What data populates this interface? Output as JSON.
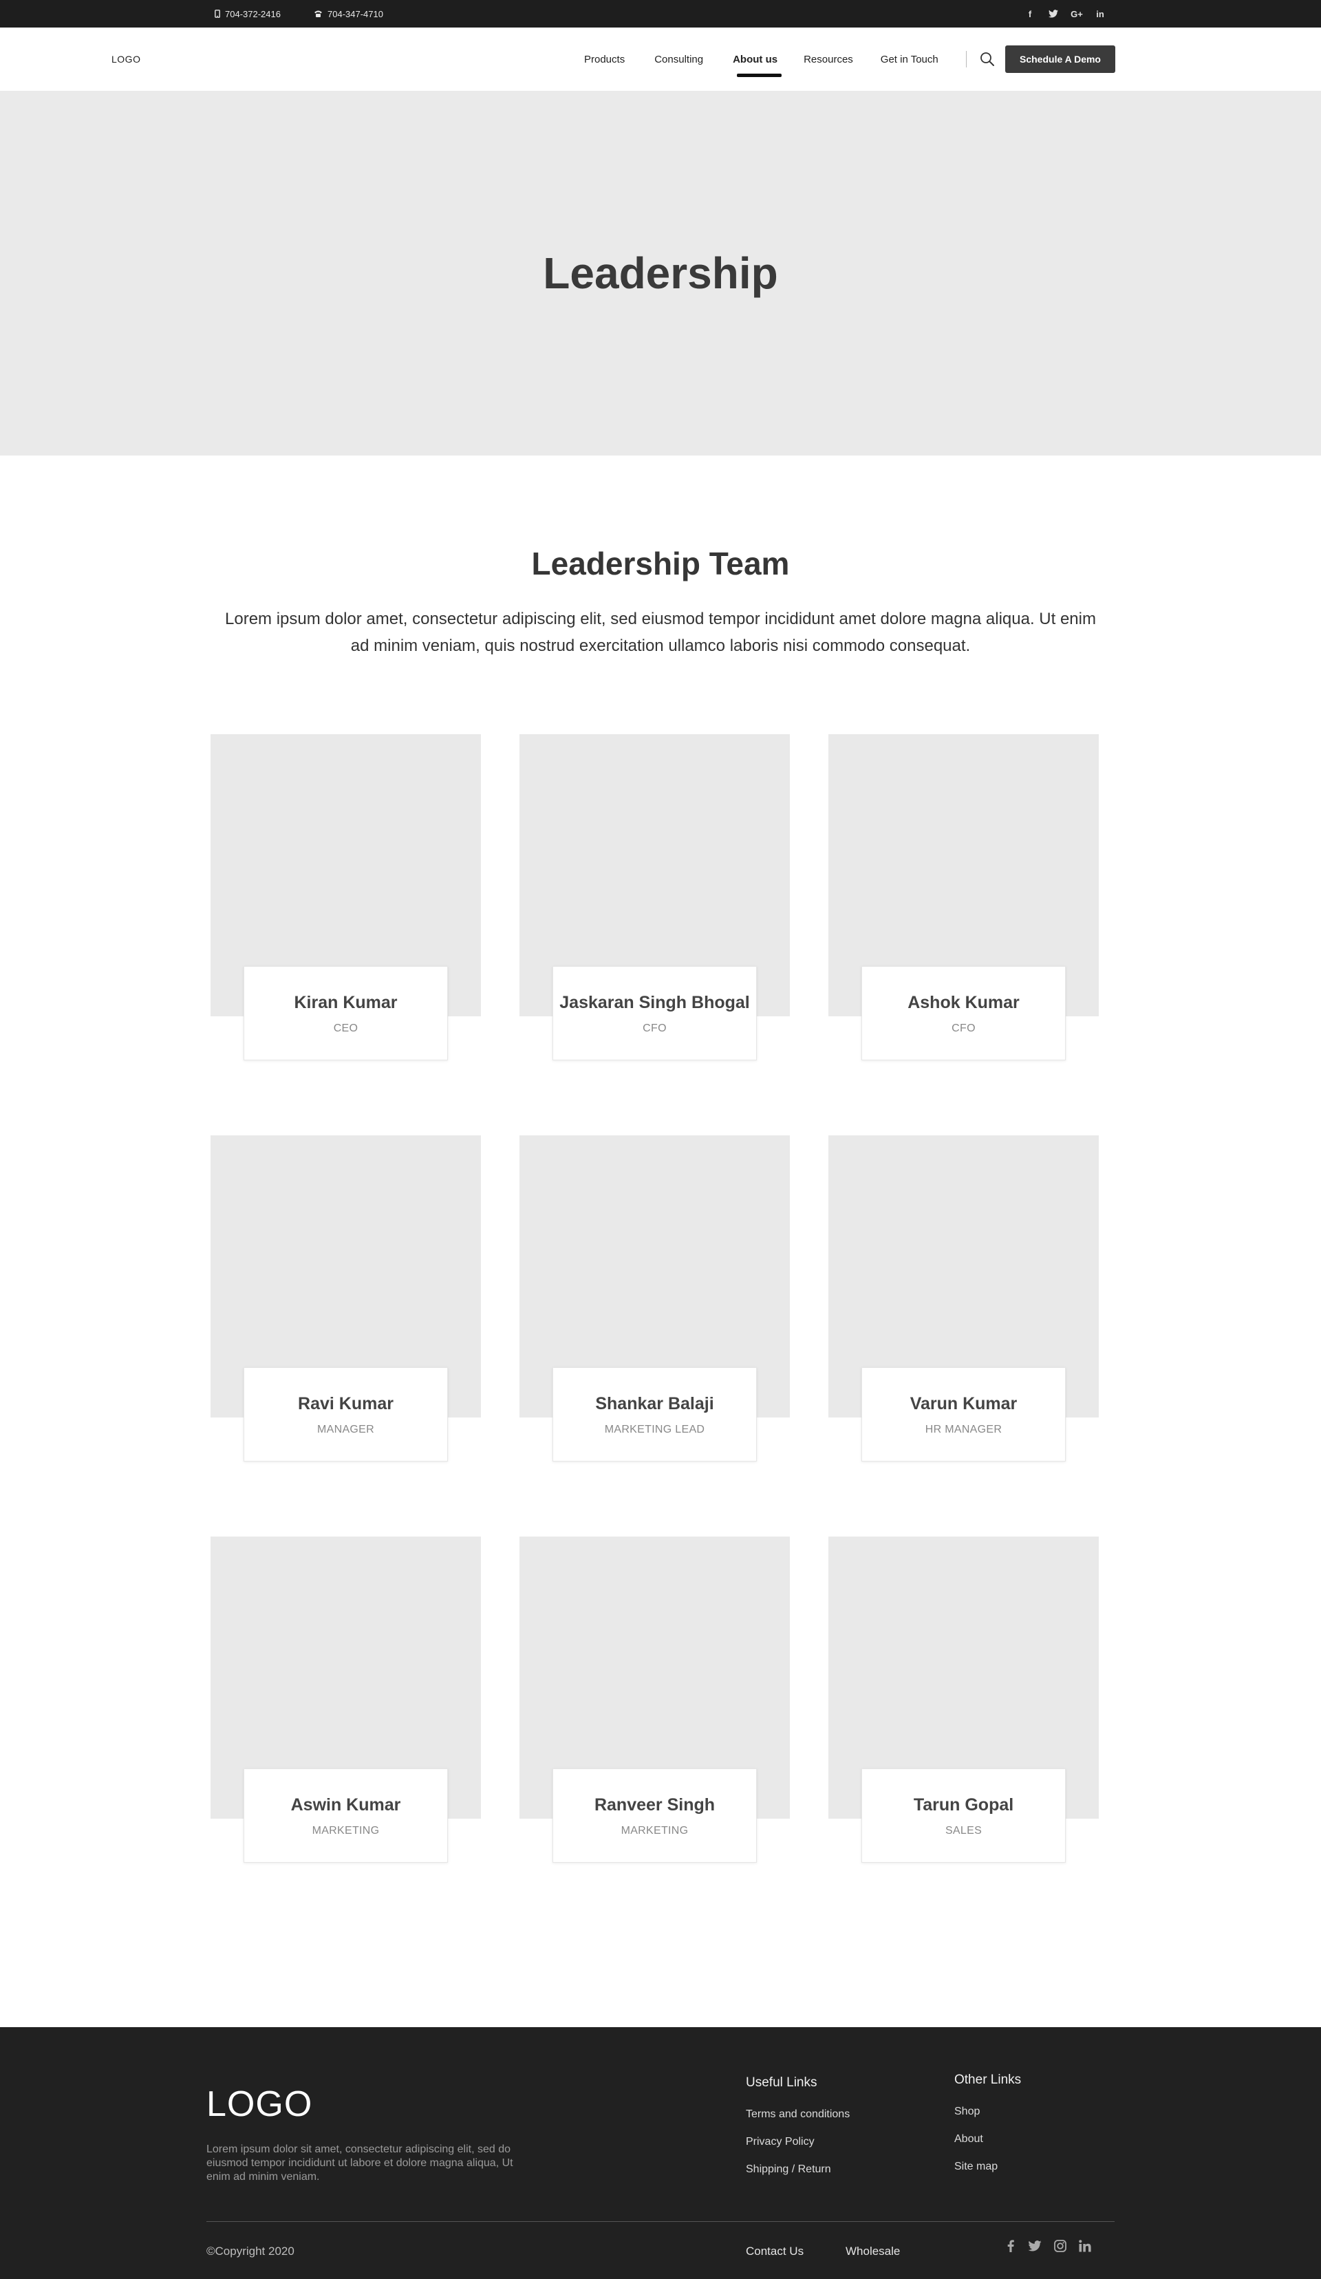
{
  "topbar": {
    "phone1": "704-372-2416",
    "phone2": "704-347-4710",
    "social_icons": [
      "facebook-icon",
      "twitter-icon",
      "google-plus-icon",
      "linkedin-icon"
    ],
    "social_glyphs": [
      "f",
      "t",
      "G+",
      "in"
    ]
  },
  "nav": {
    "logo": "LOGO",
    "items": [
      {
        "label": "Products"
      },
      {
        "label": "Consulting"
      },
      {
        "label": "About us",
        "active": true
      },
      {
        "label": "Resources"
      },
      {
        "label": "Get in Touch"
      }
    ],
    "cta": "Schedule A Demo"
  },
  "hero": {
    "title": "Leadership"
  },
  "team": {
    "title": "Leadership Team",
    "intro": "Lorem ipsum dolor amet, consectetur adipiscing elit, sed eiusmod tempor incididunt amet dolore magna aliqua. Ut enim ad minim veniam, quis nostrud exercitation ullamco laboris nisi commodo consequat.",
    "members": [
      {
        "name": "Kiran Kumar",
        "role": "CEO"
      },
      {
        "name": "Jaskaran Singh Bhogal",
        "role": "CFO"
      },
      {
        "name": "Ashok Kumar",
        "role": "CFO"
      },
      {
        "name": "Ravi Kumar",
        "role": "MANAGER"
      },
      {
        "name": "Shankar Balaji",
        "role": "MARKETING LEAD"
      },
      {
        "name": "Varun Kumar",
        "role": "HR MANAGER"
      },
      {
        "name": "Aswin Kumar",
        "role": "MARKETING"
      },
      {
        "name": "Ranveer Singh",
        "role": "MARKETING"
      },
      {
        "name": "Tarun Gopal",
        "role": "SALES"
      }
    ]
  },
  "footer": {
    "logo": "LOGO",
    "description": "Lorem ipsum dolor sit amet, consectetur adipiscing elit, sed do eiusmod tempor incididunt ut labore et dolore magna aliqua, Ut enim ad minim veniam.",
    "useful_links": {
      "title": "Useful Links",
      "links": [
        "Terms and conditions",
        "Privacy Policy",
        "Shipping / Return"
      ]
    },
    "other_links": {
      "title": "Other Links",
      "links": [
        "Shop",
        "About",
        "Site map"
      ]
    },
    "copyright": "©Copyright 2020",
    "bottom_links": [
      "Contact Us",
      "Wholesale"
    ],
    "social_icons": [
      "facebook-icon",
      "twitter-icon",
      "instagram-icon",
      "linkedin-icon"
    ]
  }
}
